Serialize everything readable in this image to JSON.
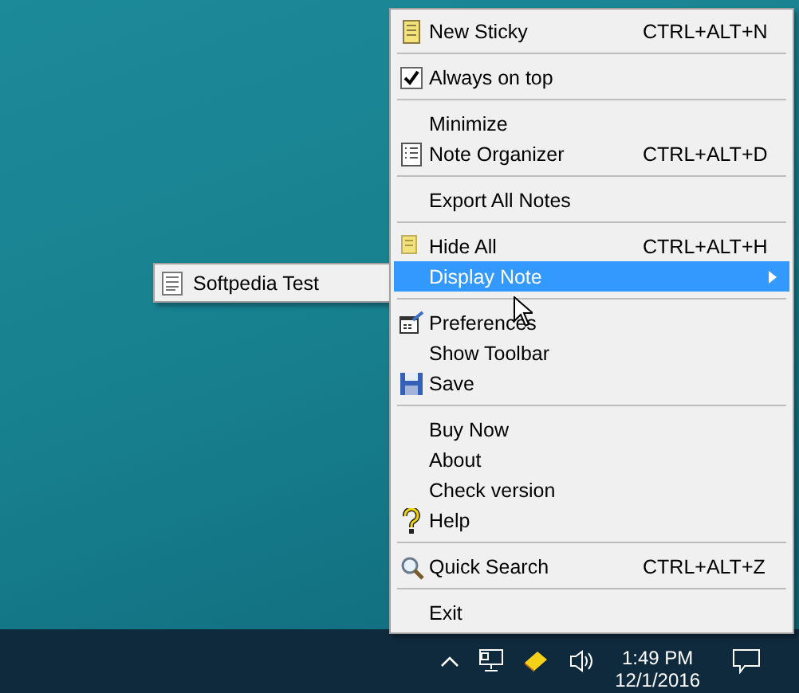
{
  "menu": {
    "sections": [
      [
        {
          "label": "New Sticky",
          "shortcut": "CTRL+ALT+N",
          "selected": false
        }
      ],
      [
        {
          "label": "Always on top",
          "kind": "checkbox",
          "checked": true,
          "selected": false
        }
      ],
      [
        {
          "label": "Minimize",
          "selected": false
        },
        {
          "label": "Note Organizer",
          "shortcut": "CTRL+ALT+D",
          "selected": false
        }
      ],
      [
        {
          "label": "Export All Notes",
          "selected": false
        }
      ],
      [
        {
          "label": "Hide All",
          "shortcut": "CTRL+ALT+H",
          "selected": false
        },
        {
          "label": "Display Note",
          "kind": "submenu",
          "selected": true
        }
      ],
      [
        {
          "label": "Preferences",
          "selected": false
        },
        {
          "label": "Show Toolbar",
          "selected": false
        },
        {
          "label": "Save",
          "selected": false
        }
      ],
      [
        {
          "label": "Buy Now",
          "selected": false
        },
        {
          "label": "About",
          "selected": false
        },
        {
          "label": "Check version",
          "selected": false
        },
        {
          "label": "Help",
          "selected": false
        }
      ],
      [
        {
          "label": "Quick Search",
          "shortcut": "CTRL+ALT+Z",
          "selected": false
        }
      ],
      [
        {
          "label": "Exit",
          "selected": false
        }
      ]
    ]
  },
  "submenu": {
    "items": [
      {
        "label": "Softpedia Test",
        "selected": false
      }
    ]
  },
  "taskbar": {
    "time": "1:49 PM",
    "date": "12/1/2016"
  }
}
